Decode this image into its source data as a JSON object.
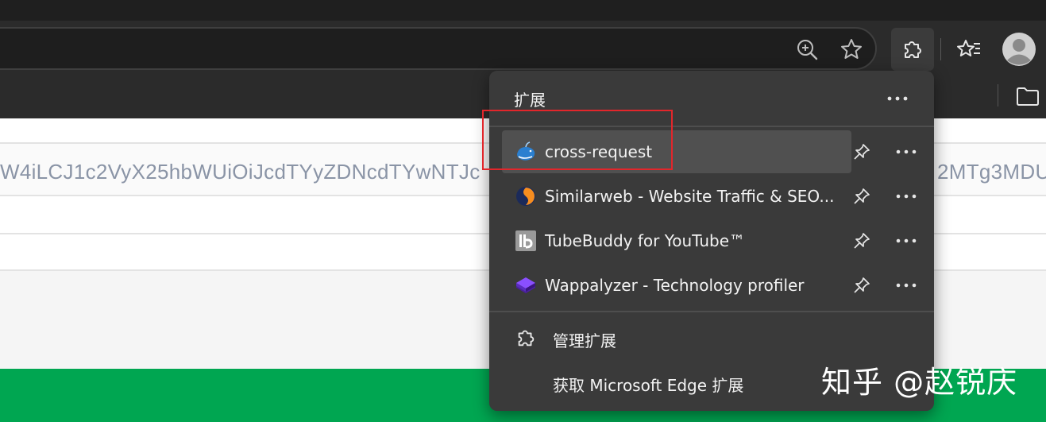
{
  "toolbar": {
    "zoom_icon": "zoom-in-icon",
    "favorite_icon": "star-icon",
    "extensions_icon": "puzzle-icon",
    "favorites_icon": "favorites-star-list-icon",
    "profile_icon": "avatar-icon"
  },
  "page": {
    "token_left": "W4iLCJ1c2VyX25hbWUiOiJcdTYyZDNcdTYwNTJc",
    "token_right": "2MTg3MDU"
  },
  "popup": {
    "title": "扩展",
    "extensions": [
      {
        "name": "cross-request",
        "icon": "whale-icon",
        "color": "#2a7fd0"
      },
      {
        "name": "Similarweb - Website Traffic & SEO...",
        "icon": "similarweb-icon",
        "color": "#f68d1f"
      },
      {
        "name": "TubeBuddy for YouTube™",
        "icon": "tubebuddy-icon",
        "color": "#9a9a9a"
      },
      {
        "name": "Wappalyzer - Technology profiler",
        "icon": "wappalyzer-icon",
        "color": "#6b2fd0"
      }
    ],
    "manage_label": "管理扩展",
    "get_label": "获取 Microsoft Edge 扩展"
  },
  "watermark": "知乎 @赵锐庆",
  "colors": {
    "accent_green": "#00a651",
    "highlight_red": "#e2262b",
    "popup_bg": "#3a3a3a"
  }
}
